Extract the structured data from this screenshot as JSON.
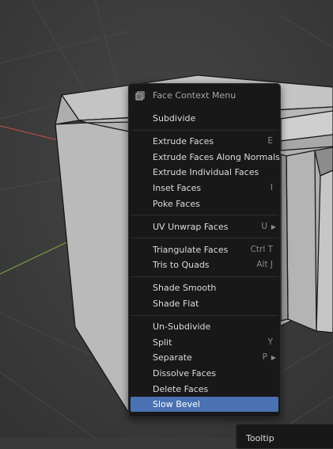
{
  "menu": {
    "title": "Face Context Menu",
    "title_icon": "face-context-icon",
    "sections": [
      [
        {
          "label": "Subdivide",
          "shortcut": ""
        }
      ],
      [
        {
          "label": "Extrude Faces",
          "shortcut": "E"
        },
        {
          "label": "Extrude Faces Along Normals",
          "shortcut": ""
        },
        {
          "label": "Extrude Individual Faces",
          "shortcut": ""
        },
        {
          "label": "Inset Faces",
          "shortcut": "I"
        },
        {
          "label": "Poke Faces",
          "shortcut": ""
        }
      ],
      [
        {
          "label": "UV Unwrap Faces",
          "shortcut": "U",
          "submenu": true
        }
      ],
      [
        {
          "label": "Triangulate Faces",
          "shortcut": "Ctrl T"
        },
        {
          "label": "Tris to Quads",
          "shortcut": "Alt J"
        }
      ],
      [
        {
          "label": "Shade Smooth",
          "shortcut": ""
        },
        {
          "label": "Shade Flat",
          "shortcut": ""
        }
      ],
      [
        {
          "label": "Un-Subdivide",
          "shortcut": ""
        },
        {
          "label": "Split",
          "shortcut": "Y"
        },
        {
          "label": "Separate",
          "shortcut": "P",
          "submenu": true
        },
        {
          "label": "Dissolve Faces",
          "shortcut": ""
        },
        {
          "label": "Delete Faces",
          "shortcut": ""
        },
        {
          "label": "Slow Bevel",
          "shortcut": "",
          "active": true
        }
      ]
    ]
  },
  "tooltip": {
    "text": "Tooltip"
  },
  "colors": {
    "menu_bg": "#181818",
    "highlight": "#4a72b2",
    "text": "#dcdcdc",
    "shortcut": "#8a8a8a",
    "viewport_bg": "#3a3a3a",
    "mesh_light": "#bdbdbd",
    "axis_x": "#b34a4a",
    "axis_y": "#7aa33a"
  }
}
